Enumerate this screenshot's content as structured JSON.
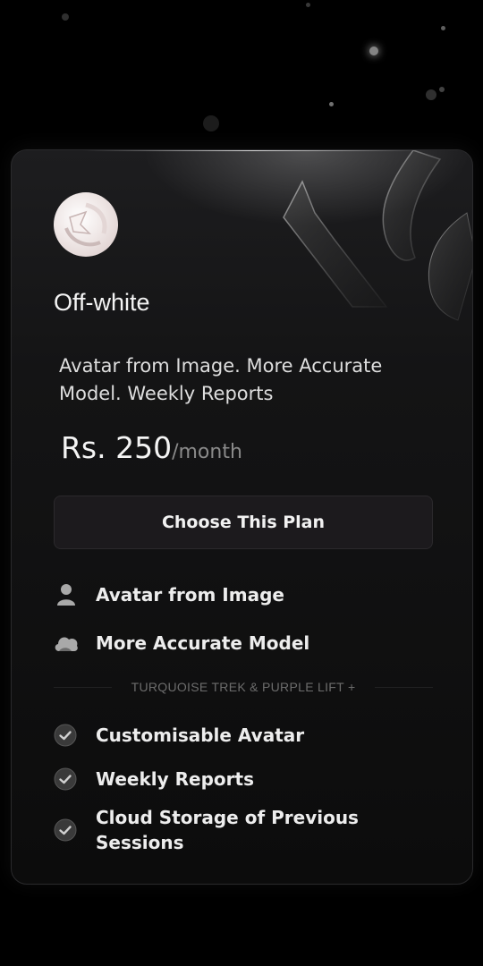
{
  "plan": {
    "name": "Off-white",
    "description": "Avatar from Image. More Accurate Model. Weekly Reports",
    "price_amount": "Rs. 250",
    "price_period": "/month",
    "cta_label": "Choose This Plan"
  },
  "primary_features": [
    {
      "icon": "user-icon",
      "label": "Avatar from Image"
    },
    {
      "icon": "cloud-icon",
      "label": "More Accurate Model"
    }
  ],
  "divider_label": "TURQUOISE TREK & PURPLE LIFT +",
  "included_features": [
    {
      "icon": "check-circle-icon",
      "label": "Customisable Avatar"
    },
    {
      "icon": "check-circle-icon",
      "label": "Weekly Reports"
    },
    {
      "icon": "check-circle-icon",
      "label": "Cloud Storage of Previous Sessions"
    }
  ],
  "colors": {
    "background": "#000000",
    "card": "#141415",
    "button": "#1c1a1d",
    "text": "#f2f2f2",
    "muted": "#8a8a8a"
  }
}
